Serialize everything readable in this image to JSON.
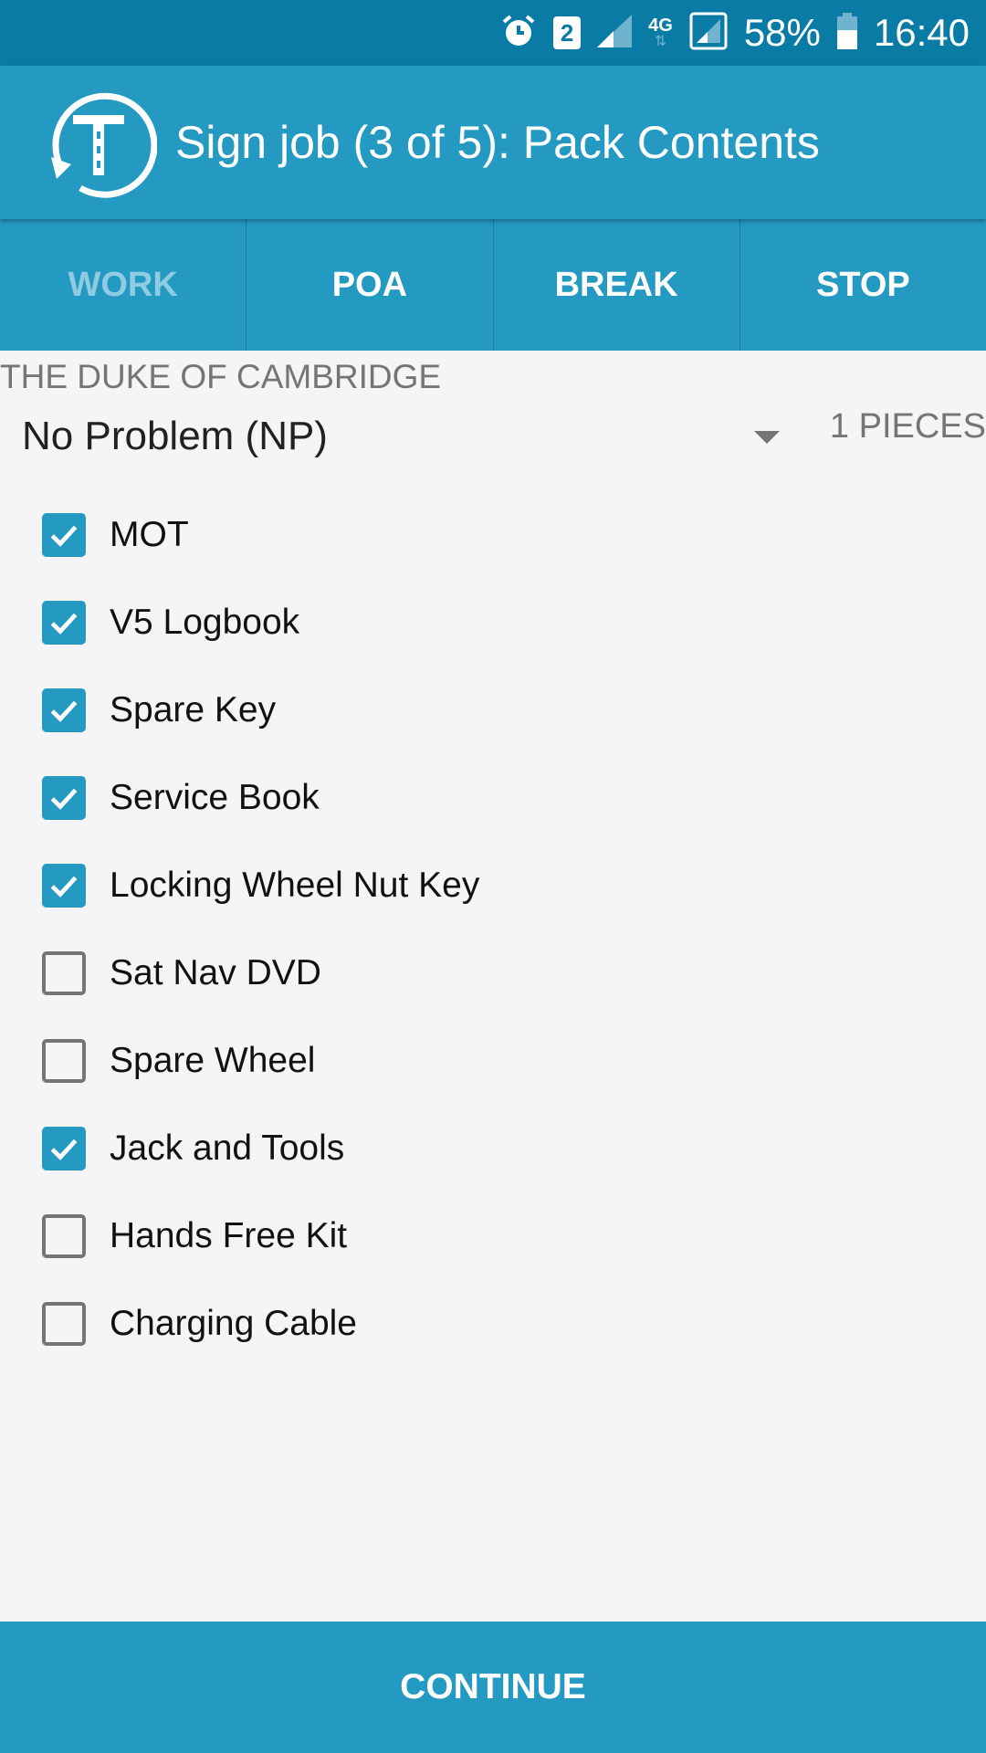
{
  "status_bar": {
    "icons": [
      "alarm-icon",
      "sim2-icon",
      "signal-icon",
      "4g-data-icon",
      "signal-boxed-icon"
    ],
    "sim_badge": "2",
    "network": "4G",
    "battery": "58%",
    "battery_level": 0.58,
    "time": "16:40"
  },
  "app_bar": {
    "logo_letter": "T",
    "title": "Sign job (3 of 5): Pack Contents"
  },
  "tabs": [
    {
      "label": "WORK",
      "active": true
    },
    {
      "label": "POA",
      "active": false
    },
    {
      "label": "BREAK",
      "active": false
    },
    {
      "label": "STOP",
      "active": false
    }
  ],
  "job": {
    "location": "THE DUKE OF CAMBRIDGE",
    "status_select": "No Problem (NP)",
    "pieces": "1 PIECES"
  },
  "checklist": [
    {
      "label": "MOT",
      "checked": true
    },
    {
      "label": "V5 Logbook",
      "checked": true
    },
    {
      "label": "Spare Key",
      "checked": true
    },
    {
      "label": "Service Book",
      "checked": true
    },
    {
      "label": "Locking Wheel Nut Key",
      "checked": true
    },
    {
      "label": "Sat Nav DVD",
      "checked": false
    },
    {
      "label": "Spare Wheel",
      "checked": false
    },
    {
      "label": "Jack and Tools",
      "checked": true
    },
    {
      "label": "Hands Free Kit",
      "checked": false
    },
    {
      "label": "Charging Cable",
      "checked": false
    }
  ],
  "footer": {
    "continue_label": "CONTINUE"
  },
  "colors": {
    "status_bar": "#0a7ba5",
    "primary": "#2499c1",
    "inactive_tab_text": "#8fcbe2",
    "background": "#f5f5f5",
    "secondary_text": "#757575"
  }
}
